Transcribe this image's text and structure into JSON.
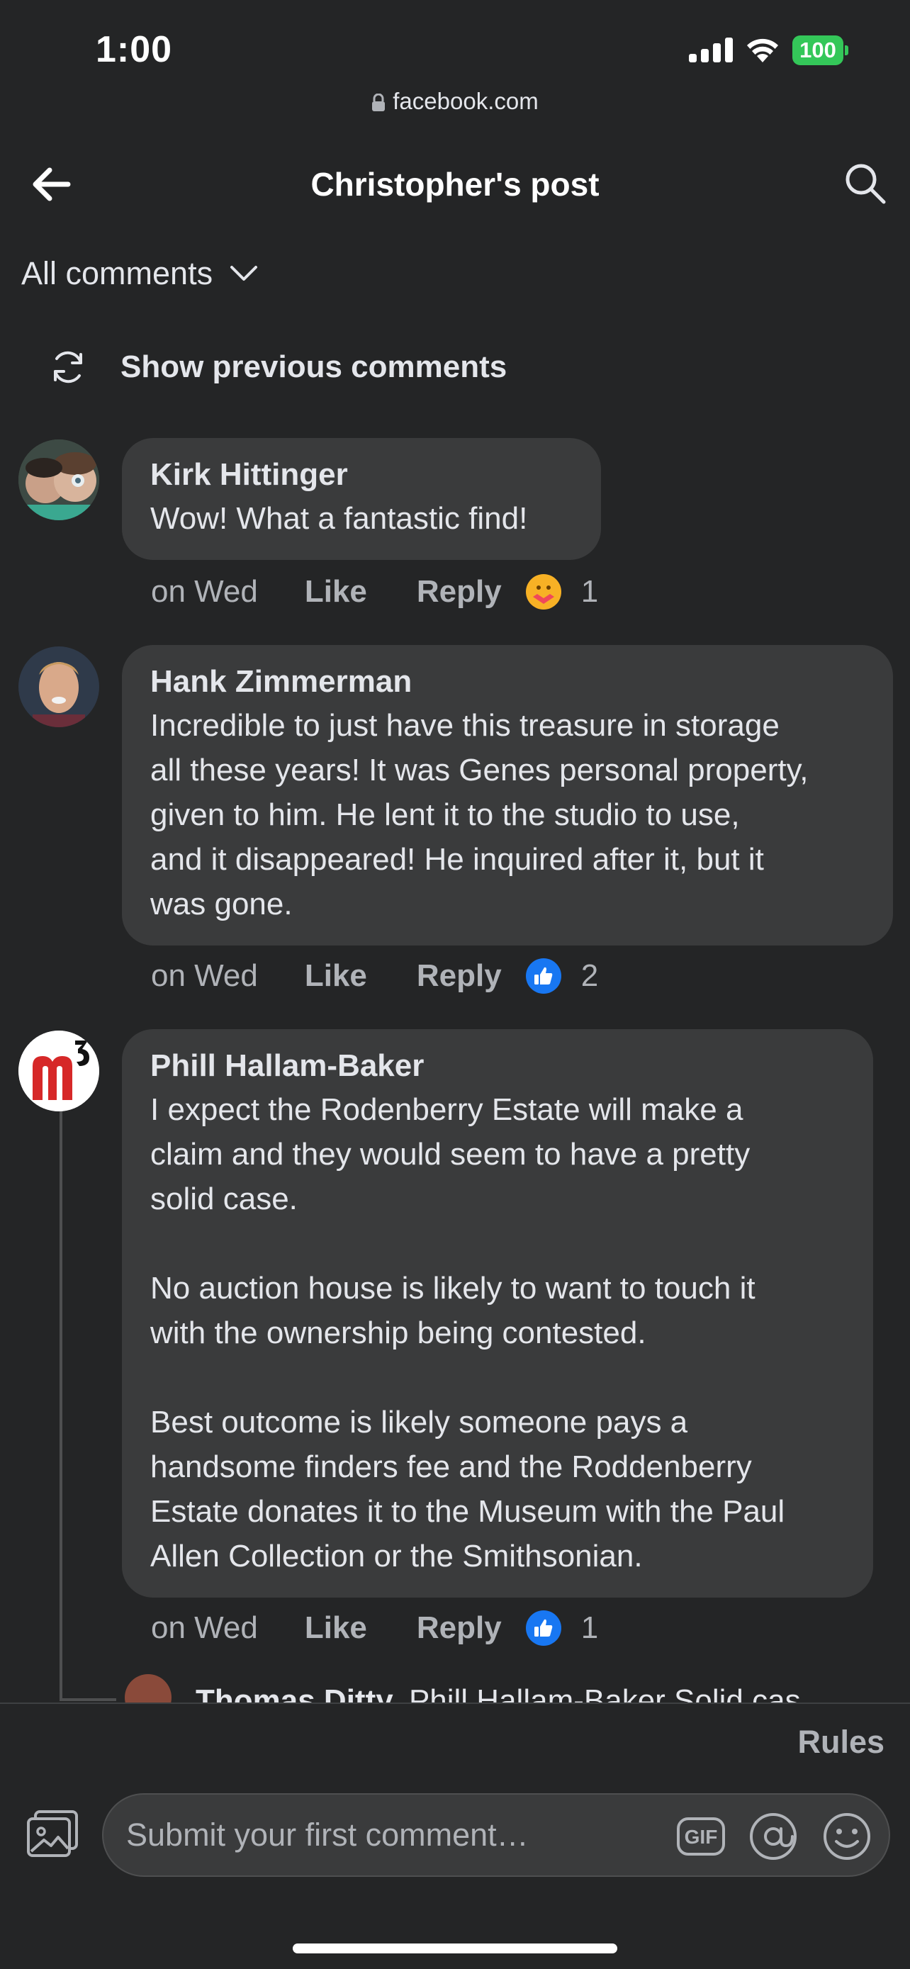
{
  "status_bar": {
    "time": "1:00",
    "battery": "100"
  },
  "browser": {
    "url": "facebook.com"
  },
  "header": {
    "title": "Christopher's post"
  },
  "filter": {
    "label": "All comments"
  },
  "show_previous": {
    "label": "Show previous comments"
  },
  "comments": [
    {
      "author": "Kirk Hittinger",
      "text": "Wow! What a fantastic find!",
      "time": "on Wed",
      "like_label": "Like",
      "reply_label": "Reply",
      "reaction": "care",
      "reaction_count": "1"
    },
    {
      "author": "Hank Zimmerman",
      "text": "Incredible to just have this treasure in storage\nall these years!  It was Genes personal property,\ngiven to him.  He lent it to the studio to use,\nand it disappeared!  He inquired after it, but it\nwas gone.",
      "time": "on Wed",
      "like_label": "Like",
      "reply_label": "Reply",
      "reaction": "like",
      "reaction_count": "2"
    },
    {
      "author": "Phill Hallam-Baker",
      "text": "I expect the Rodenberry Estate will make a\nclaim and they would seem to have a pretty\nsolid case.\n\nNo auction house is likely to want to touch it\nwith the ownership being contested.\n\nBest outcome is likely someone pays a\nhandsome finders fee and the Roddenberry\nEstate donates it to the Museum with the Paul\nAllen Collection or the Smithsonian.",
      "time": "on Wed",
      "like_label": "Like",
      "reply_label": "Reply",
      "reaction": "like",
      "reaction_count": "1"
    }
  ],
  "reply_preview": {
    "author": "Thomas Ditty",
    "text": "Phill Hallam-Baker Solid cas"
  },
  "footer": {
    "rules_label": "Rules",
    "composer_placeholder": "Submit your first comment…",
    "gif_label": "GIF"
  },
  "colors": {
    "background": "#242526",
    "bubble": "#3a3b3c",
    "like_blue": "#1877f2",
    "battery_green": "#34c759"
  }
}
